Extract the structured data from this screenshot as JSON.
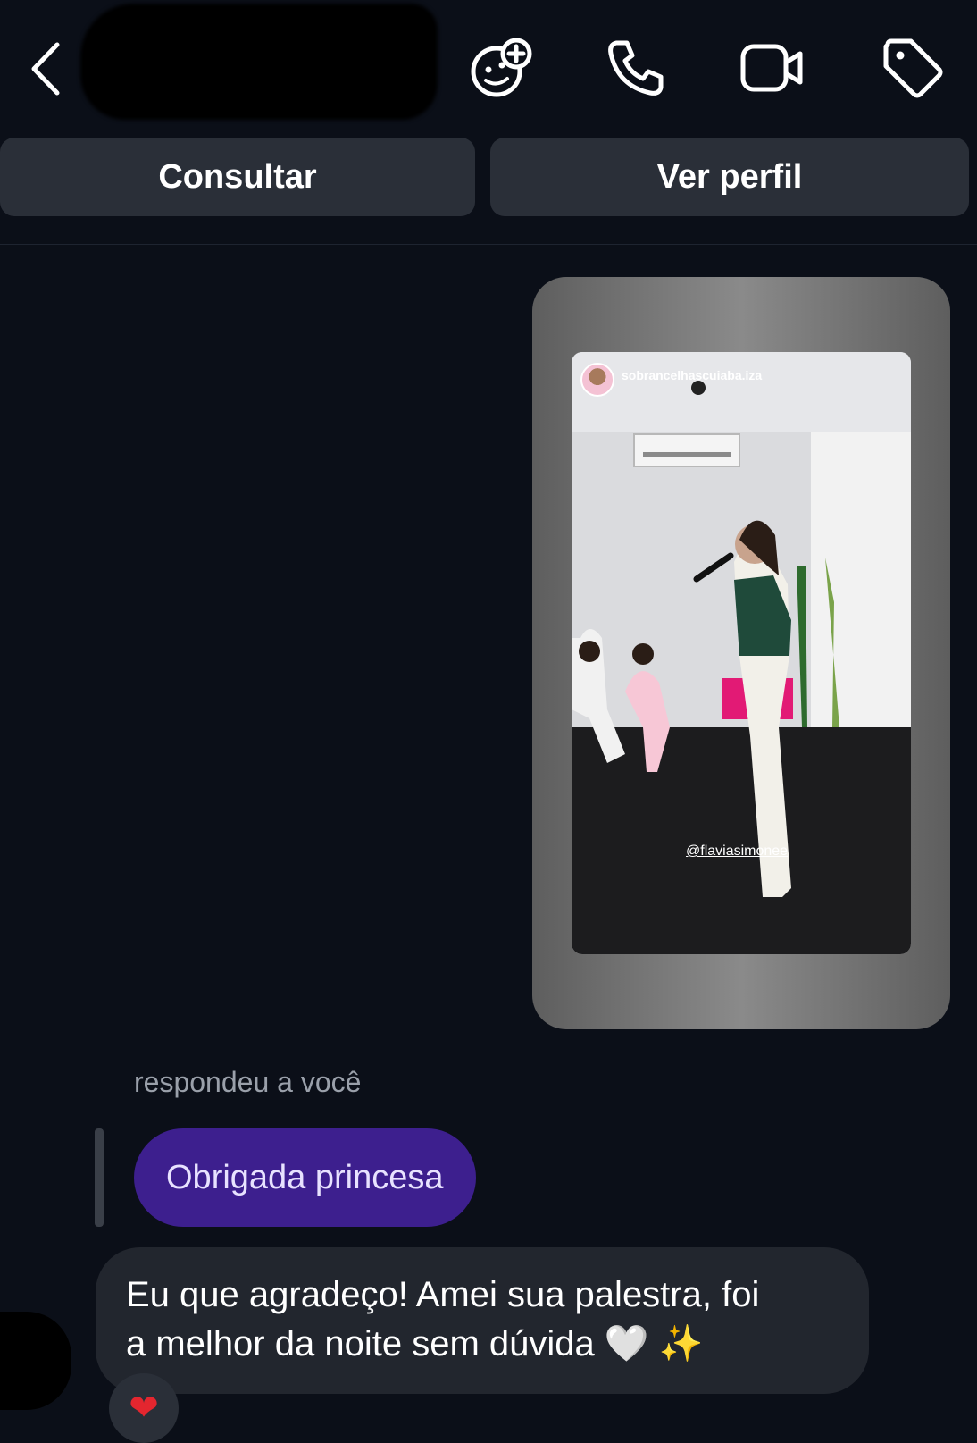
{
  "header": {
    "icons": [
      "back-icon",
      "effects-icon",
      "call-icon",
      "video-icon",
      "tag-icon"
    ]
  },
  "actions": {
    "consult_label": "Consultar",
    "profile_label": "Ver perfil"
  },
  "story": {
    "username": "sobrancelhascuiaba.iza",
    "mention": "@flaviasimonee"
  },
  "reply": {
    "label": "respondeu a você",
    "quoted_message": "Obrigada princesa"
  },
  "message": {
    "line1": "Eu que agradeço! Amei sua palestra, foi",
    "line2": "a melhor da noite sem dúvida 🤍 ✨"
  },
  "reaction": {
    "emoji": "❤"
  },
  "colors": {
    "background": "#0b0f18",
    "button": "#2a2f38",
    "purple_bubble": "#3d1f8e",
    "gray_bubble": "#22262e"
  }
}
